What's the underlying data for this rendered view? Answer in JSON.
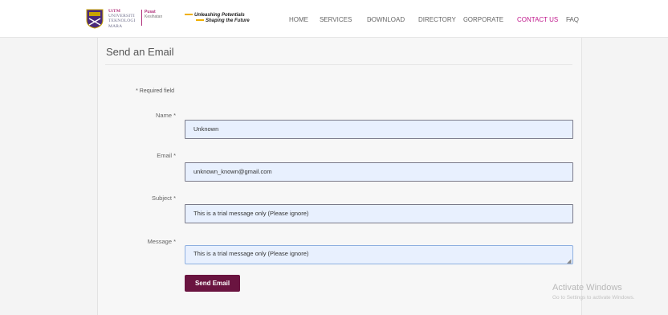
{
  "header": {
    "logo": {
      "line1": "UiTM",
      "line2": "UNIVERSITI",
      "line3": "TEKNOLOGI",
      "line4": "MARA",
      "dept_line1": "Pusat",
      "dept_line2": "Kesihatan"
    },
    "tagline": {
      "line1": "Unleashing Potentials",
      "line2": "Shaping the Future"
    },
    "nav": [
      {
        "label": "HOME"
      },
      {
        "label": "SERVICES",
        "caret": "⌄"
      },
      {
        "label": "DOWNLOAD",
        "caret": "⌄"
      },
      {
        "label": "DIRECTORY"
      },
      {
        "label": "CORPORATE",
        "caret": "⌄"
      },
      {
        "label": "CONTACT US"
      },
      {
        "label": "FAQ",
        "caret": "⌄"
      }
    ],
    "active_color": "#c0188c"
  },
  "form": {
    "title": "Send an Email",
    "required_note": "* Required field",
    "name_label": "Name *",
    "name_value": "Unknown",
    "email_label": "Email *",
    "email_value": "unknown_known@gmail.com",
    "subject_label": "Subject *",
    "subject_value": "This is a trial message only (Please ignore)",
    "message_label": "Message *",
    "message_value": "This is a trial message only (Please ignore)",
    "send_label": "Send Email",
    "button_color": "#6a1440",
    "field_bg": "#e8f0fe"
  },
  "watermark": {
    "title": "Activate Windows",
    "subtitle": "Go to Settings to activate Windows."
  }
}
